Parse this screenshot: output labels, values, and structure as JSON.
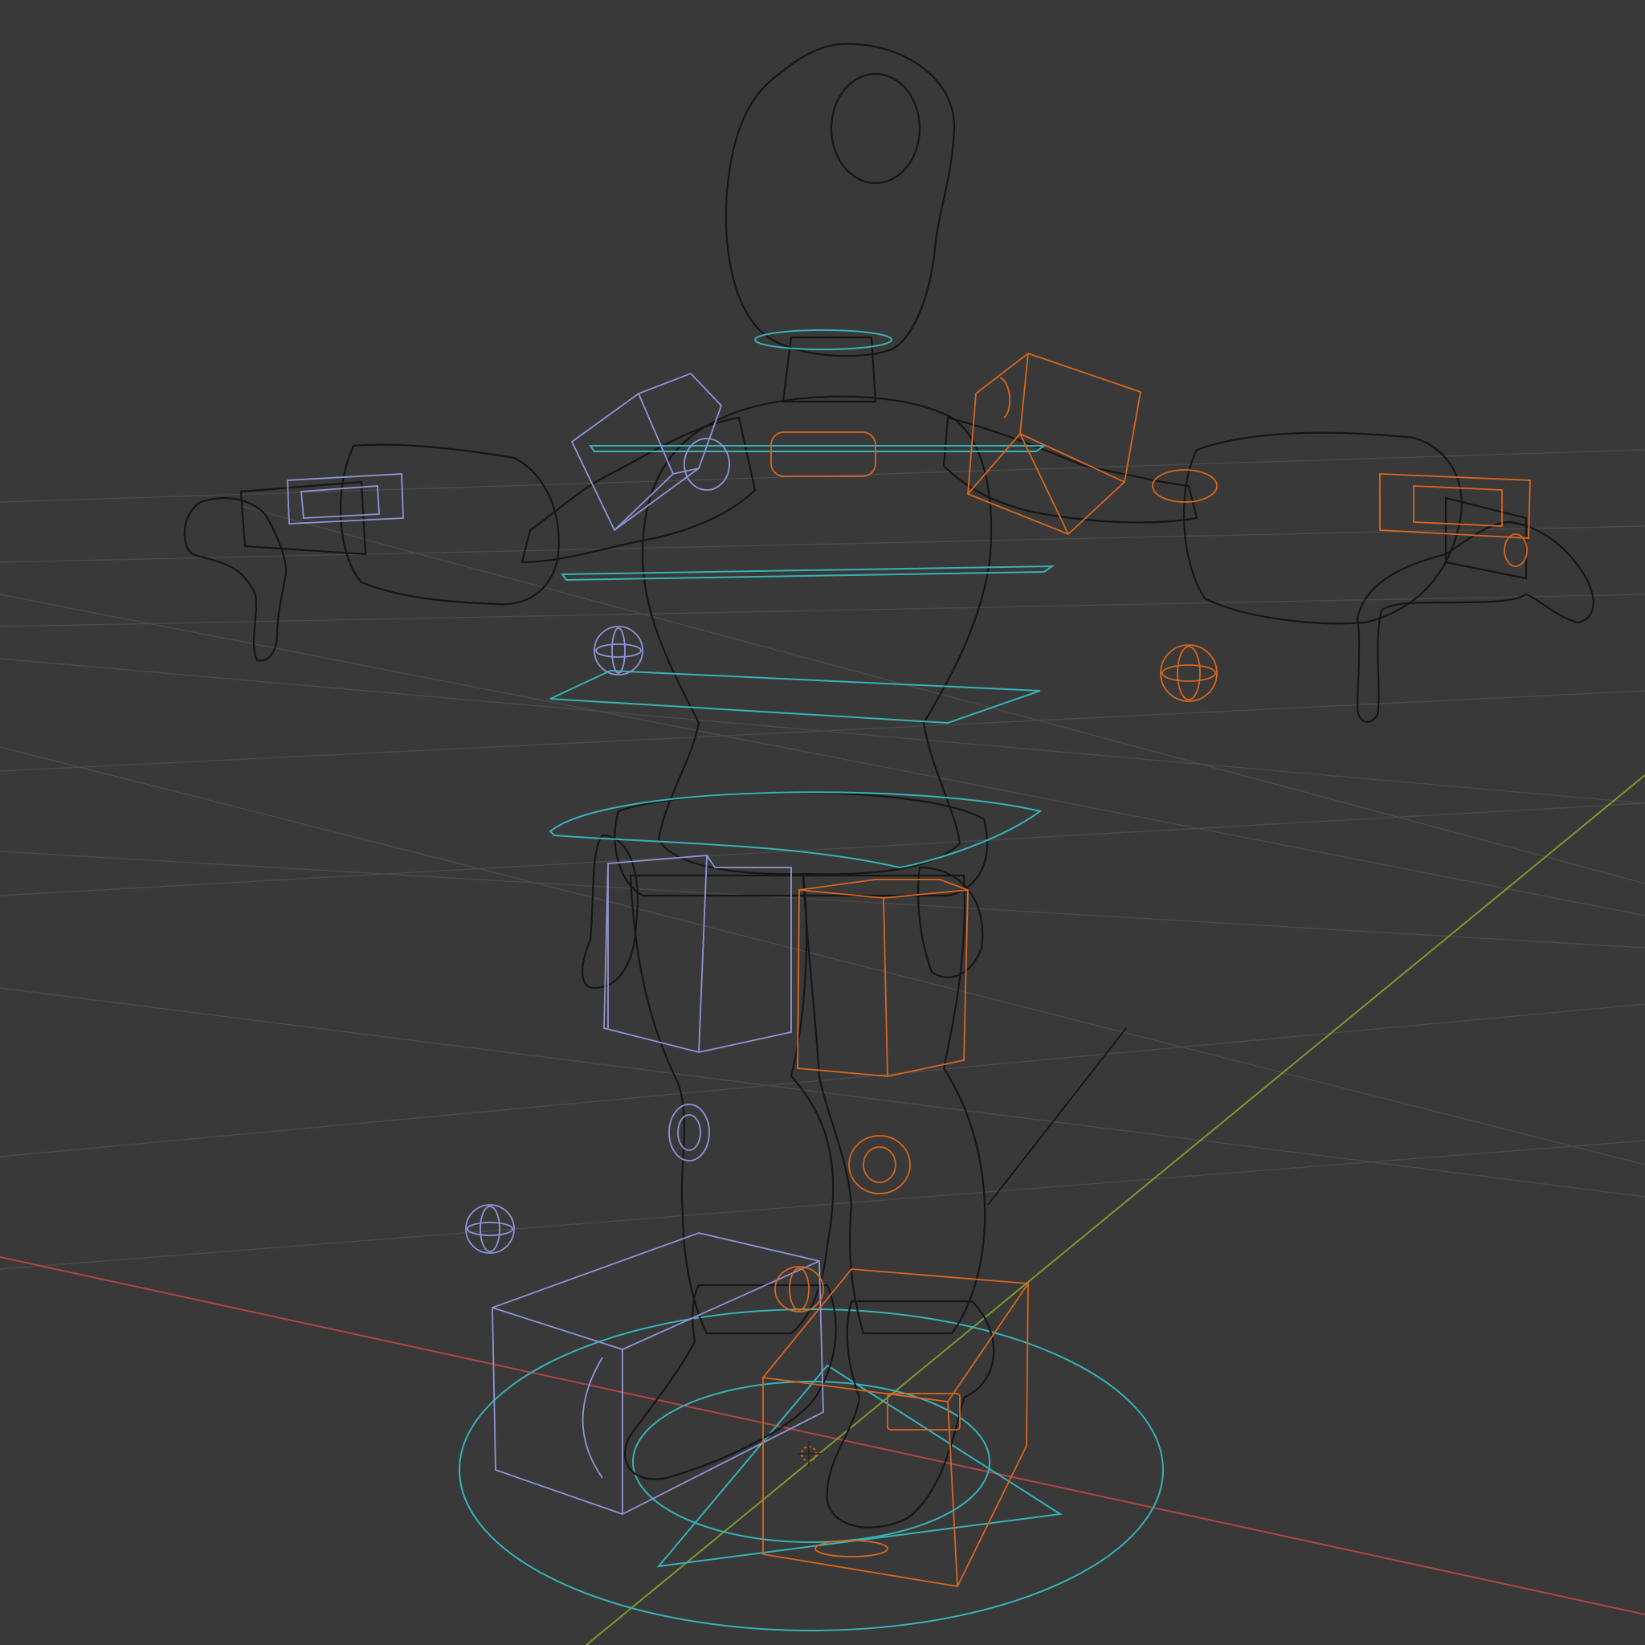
{
  "viewport": {
    "mode": "wireframe",
    "grid": true,
    "colors": {
      "background": "#393939",
      "grid": "#4b4b4b",
      "axis_x": "#b04646",
      "axis_y": "#7a9a2e",
      "mesh": "#1c1c1c",
      "mesh_fill": "#2f2f2f",
      "control_left": "#8e95d8",
      "control_right": "#d9661f",
      "control_center": "#36b3b8"
    },
    "objects": {
      "character": "rigged-character-mesh",
      "armature_controls_left": "fk-ik-controls-left",
      "armature_controls_right": "fk-ik-controls-right",
      "torso_controls": "spine-controls",
      "root_control": "root-circle-control",
      "origin": "3d-cursor-icon"
    }
  }
}
